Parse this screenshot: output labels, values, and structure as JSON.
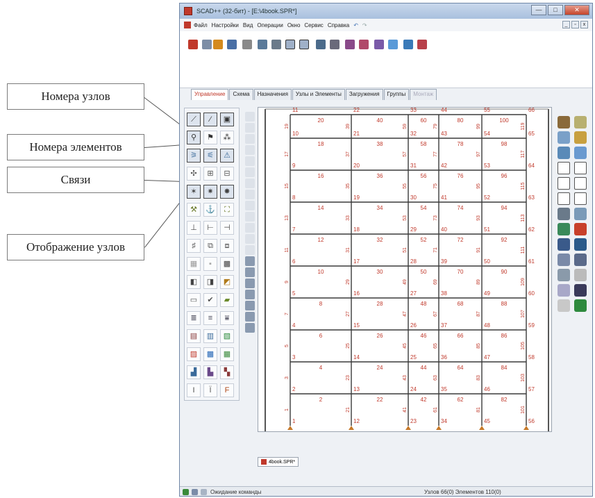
{
  "callouts": [
    {
      "text": "Номера узлов"
    },
    {
      "text": "Номера элементов"
    },
    {
      "text": "Связи"
    },
    {
      "text": "Отображение узлов"
    }
  ],
  "window": {
    "title": "SCAD++ (32-бит) - [E:\\4book.SPR*]",
    "buttons": {
      "minimize": "—",
      "maximize": "□",
      "close": "✕"
    },
    "mdi_controls": [
      "_",
      "▫",
      "x"
    ]
  },
  "menu": {
    "items": [
      "Файл",
      "Настройки",
      "Вид",
      "Операции",
      "Окно",
      "Сервис",
      "Справка"
    ],
    "undo": "↶",
    "redo": "↷"
  },
  "tabs": [
    {
      "label": "Управление",
      "state": "active"
    },
    {
      "label": "Схема",
      "state": "normal"
    },
    {
      "label": "Назначения",
      "state": "normal"
    },
    {
      "label": "Узлы и Элементы",
      "state": "normal"
    },
    {
      "label": "Загружения",
      "state": "normal"
    },
    {
      "label": "Группы",
      "state": "normal"
    },
    {
      "label": "Монтаж",
      "state": "disabled"
    }
  ],
  "toolbar_icons": [
    "open-icon",
    "new-icon",
    "edit-icon",
    "save-icon",
    "print-icon",
    "tree-icon",
    "properties-icon",
    "grid-view-icon",
    "grid-view2-icon",
    "table-icon",
    "search-icon",
    "report-icon",
    "chart-icon",
    "graph-icon",
    "settings-icon",
    "export-icon",
    "results-icon"
  ],
  "left_tools": [
    "node-select-icon",
    "element-select-icon",
    "box-icon",
    "node-numbers-icon",
    "element-flag-icon",
    "node-marks-icon",
    "element-numbers-icon",
    "element-numbers-alt-icon",
    "element-type-icon",
    "restraint-show-icon",
    "restraint-node-icon",
    "restraint-link-icon",
    "link-icon",
    "link-alt-icon",
    "link-cross-icon",
    "hinge-icon",
    "hinge-alt-icon",
    "hinge-box-icon",
    "axes-icon",
    "axes-local-icon",
    "axes-rotate-icon",
    "rigid-icon",
    "rigid-alt-icon",
    "rigid-end-icon",
    "node-display-icon",
    "node-dot-icon",
    "mesh-icon",
    "solid-icon",
    "cube-icon",
    "color-icon",
    "frame-icon",
    "check-icon",
    "loads-icon",
    "profile-icon",
    "profile-alt-icon",
    "profile-mesh-icon",
    "section-icon",
    "section-alt-icon",
    "section-list-icon",
    "grid-red-icon",
    "grid-blue-icon",
    "grid-green-icon",
    "table-a-icon",
    "table-b-icon",
    "table-c-icon",
    "font-icon",
    "font-alt-icon",
    "font-f-icon"
  ],
  "right_tools": [
    "node-icon",
    "eraser-icon",
    "shapes-icon",
    "levels-icon",
    "filter-icon",
    "rect-icon",
    "cube-view-icon",
    "cube-outline-icon",
    "box-view-icon",
    "box-alt-icon",
    "dashes-icon",
    "grid-icon",
    "magnifier-icon",
    "zoom-icon",
    "hat-icon",
    "bed-icon",
    "brush-icon",
    "circle-icon",
    "ball-icon",
    "cross-icon",
    "table-view-icon",
    "green-square-icon",
    "wire-cube-icon",
    "wire-cube-alt-icon",
    "line-icon",
    "dots-icon"
  ],
  "model": {
    "node_columns": [
      [
        1,
        2,
        3,
        4,
        5,
        6,
        7,
        8,
        9,
        10,
        11
      ],
      [
        12,
        13,
        14,
        15,
        16,
        17,
        18,
        19,
        20,
        21,
        22
      ],
      [
        23,
        24,
        25,
        26,
        27,
        28,
        29,
        30,
        31,
        32,
        33
      ],
      [
        34,
        35,
        36,
        37,
        38,
        39,
        40,
        41,
        42,
        43,
        44
      ],
      [
        45,
        46,
        47,
        48,
        49,
        50,
        51,
        52,
        53,
        54,
        55
      ],
      [
        56,
        57,
        58,
        59,
        60,
        61,
        62,
        63,
        64,
        65,
        66
      ]
    ],
    "beam_numbers": [
      [
        2,
        22,
        42,
        62,
        82
      ],
      [
        4,
        24,
        44,
        64,
        84
      ],
      [
        6,
        26,
        46,
        66,
        86
      ],
      [
        8,
        28,
        48,
        68,
        88
      ],
      [
        10,
        30,
        50,
        70,
        90
      ],
      [
        12,
        32,
        52,
        72,
        92
      ],
      [
        14,
        34,
        54,
        74,
        94
      ],
      [
        16,
        36,
        56,
        76,
        96
      ],
      [
        18,
        38,
        58,
        78,
        98
      ],
      [
        20,
        40,
        60,
        80,
        100
      ]
    ],
    "column_element_numbers": [
      [
        1,
        3,
        5,
        7,
        9,
        11,
        13,
        15,
        17,
        19
      ],
      [
        21,
        23,
        25,
        27,
        29,
        31,
        33,
        35,
        37,
        39
      ],
      [
        41,
        43,
        45,
        47,
        49,
        51,
        53,
        55,
        57,
        59
      ],
      [
        61,
        63,
        65,
        67,
        69,
        71,
        73,
        75,
        77,
        79
      ],
      [
        81,
        83,
        85,
        87,
        89,
        91,
        93,
        95,
        97,
        99
      ],
      [
        101,
        103,
        105,
        107,
        109,
        111,
        113,
        115,
        117,
        119
      ]
    ],
    "label_color": "#c0392b",
    "line_color": "#3a3a3a"
  },
  "doc_tab": "4book.SPR*",
  "status": {
    "message": "Ожидание команды",
    "counts": "Узлов 66(0) Элементов 110(0)"
  }
}
